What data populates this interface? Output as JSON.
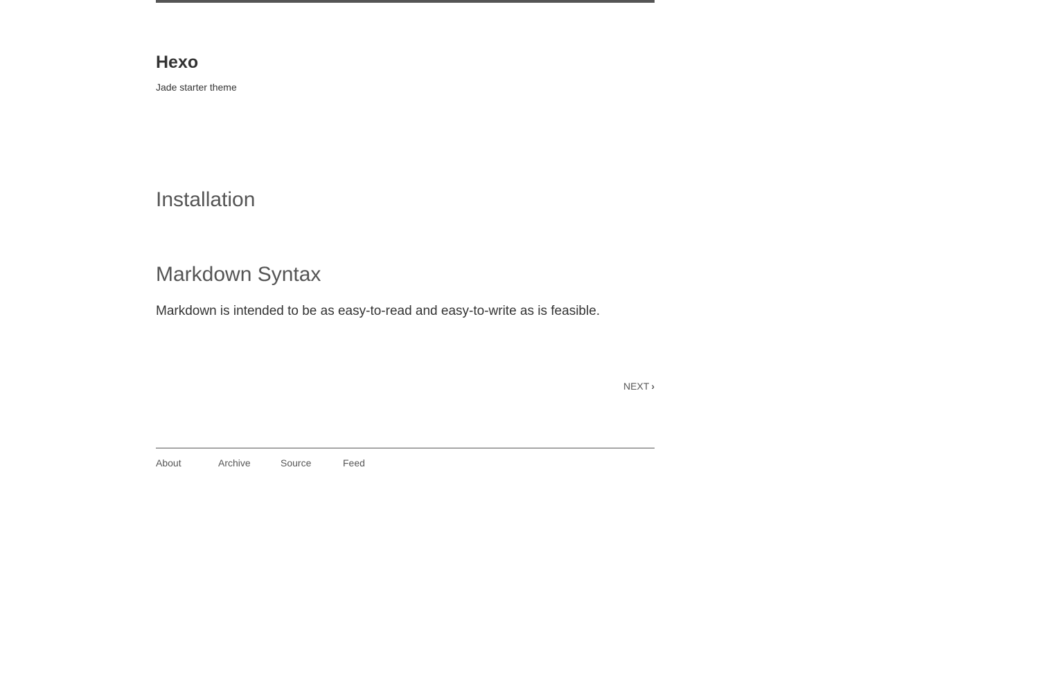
{
  "header": {
    "title": "Hexo",
    "subtitle": "Jade starter theme"
  },
  "posts": [
    {
      "title": "Installation",
      "excerpt": ""
    },
    {
      "title": "Markdown Syntax",
      "excerpt": "Markdown is intended to be as easy-to-read and easy-to-write as is feasible."
    }
  ],
  "pagination": {
    "next_label": "NEXT",
    "next_icon": "chevron-right-icon"
  },
  "footer": {
    "links": [
      "About",
      "Archive",
      "Source",
      "Feed"
    ]
  },
  "colors": {
    "text": "#333333",
    "muted": "#555555",
    "background": "#ffffff"
  }
}
